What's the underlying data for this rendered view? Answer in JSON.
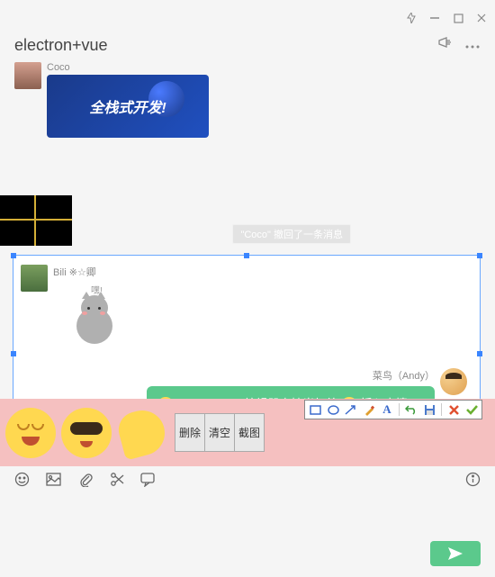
{
  "titlebar": {
    "pin_icon": "pin-icon",
    "min_icon": "minimize-icon",
    "max_icon": "maximize-icon",
    "close_icon": "close-icon"
  },
  "header": {
    "title": "electron+vue",
    "announce_icon": "announcement-icon",
    "more_icon": "more-icon"
  },
  "messages": {
    "coco_name": "Coco",
    "banner_text": "全栈式开发!",
    "recall_text": "\"Coco\" 撤回了一条消息",
    "bili_name": "Bili ※☆卿",
    "cat_speech": "嘿!",
    "andy_name": "菜鸟（Andy）",
    "andy_bubble_pre": "electron+vue编辑器支持光标处",
    "andy_bubble_post": "插入表情、支持截图"
  },
  "editor": {
    "btn_delete": "删除",
    "btn_clear": "清空",
    "btn_screenshot": "截图"
  },
  "screenshot_tools": {
    "rect": "rect",
    "ellipse": "ellipse",
    "arrow": "arrow",
    "brush": "brush",
    "text": "text",
    "undo": "undo",
    "save": "save",
    "cancel": "cancel",
    "confirm": "confirm"
  },
  "toolbar": {
    "emoji": "emoji-icon",
    "image": "image-icon",
    "attach": "attachment-icon",
    "cut": "scissors-icon",
    "chat": "chat-icon",
    "info": "info-icon"
  },
  "send": {
    "label": "send"
  }
}
